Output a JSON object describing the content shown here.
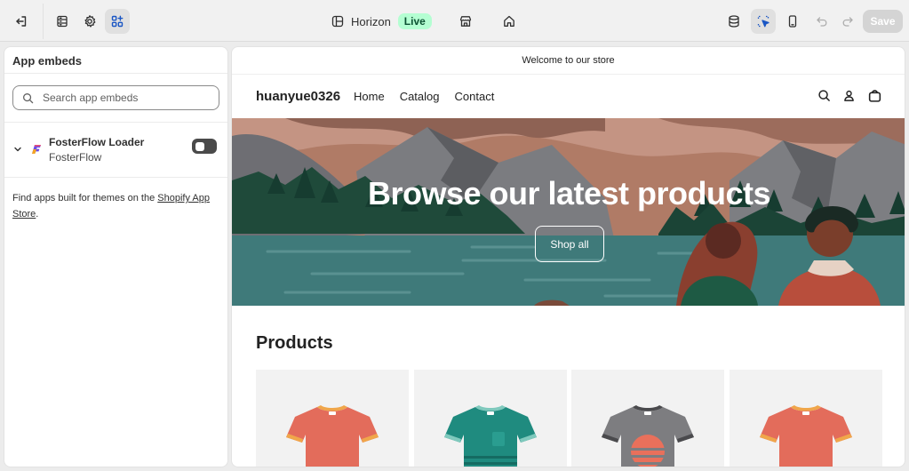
{
  "topbar": {
    "theme_name": "Horizon",
    "live_badge": "Live",
    "save_label": "Save"
  },
  "sidebar": {
    "title": "App embeds",
    "search_placeholder": "Search app embeds",
    "embed": {
      "name": "FosterFlow Loader",
      "provider": "FosterFlow",
      "enabled": false
    },
    "note_prefix": "Find apps built for themes on the ",
    "note_link": "Shopify App Store",
    "note_suffix": "."
  },
  "store": {
    "announcement": "Welcome to our store",
    "logo": "huanyue0326",
    "nav": [
      "Home",
      "Catalog",
      "Contact"
    ],
    "hero_title": "Browse our latest products",
    "hero_button": "Shop all",
    "products_title": "Products",
    "products": [
      {
        "icon": "tshirt-coral"
      },
      {
        "icon": "tshirt-teal"
      },
      {
        "icon": "tshirt-gray-sunset"
      },
      {
        "icon": "tshirt-coral"
      }
    ]
  },
  "colors": {
    "live_bg": "#b4fed2",
    "live_text": "#0c5132",
    "toggle_off": "#4a4a4a",
    "active_tool": "#e0e0e0"
  }
}
